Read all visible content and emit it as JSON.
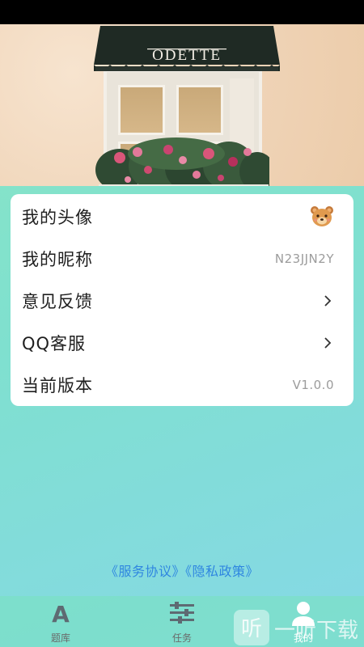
{
  "hero": {
    "sign_text": "ODETTE"
  },
  "settings": [
    {
      "label": "我的头像",
      "value": "",
      "accessory": "bear-avatar"
    },
    {
      "label": "我的昵称",
      "value": "N23JJN2Y",
      "accessory": ""
    },
    {
      "label": "意见反馈",
      "value": "",
      "accessory": "chevron-right"
    },
    {
      "label": "QQ客服",
      "value": "",
      "accessory": "chevron-right"
    },
    {
      "label": "当前版本",
      "value": "V1.0.0",
      "accessory": ""
    }
  ],
  "footer": {
    "service_agreement": "《服务协议》",
    "privacy_policy": "《隐私政策》"
  },
  "tabs": [
    {
      "label": "题库",
      "icon": "letter-a-icon",
      "active": false
    },
    {
      "label": "任务",
      "icon": "sliders-icon",
      "active": false
    },
    {
      "label": "我的",
      "icon": "user-icon",
      "active": true
    }
  ],
  "watermark": {
    "text": "一听下载",
    "glyph": "听"
  },
  "colors": {
    "link": "#2f86e0",
    "card_bg": "#ffffff",
    "tab_active": "#ffffff"
  }
}
